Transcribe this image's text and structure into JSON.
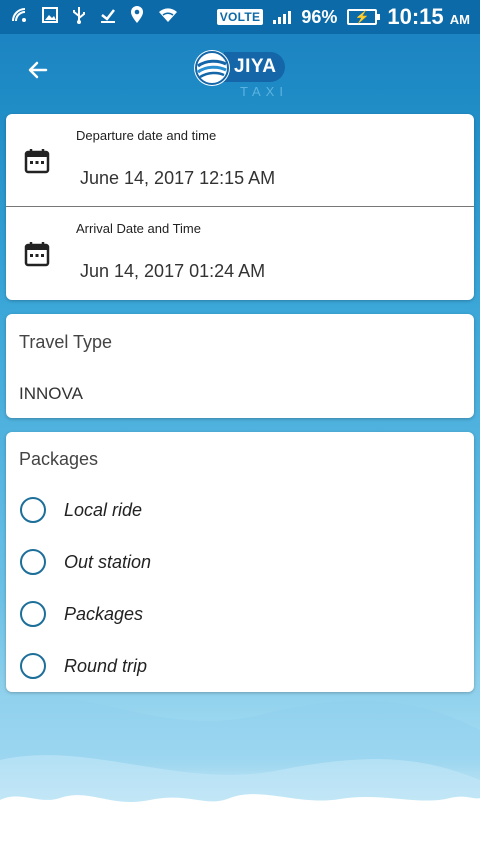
{
  "status_bar": {
    "volte": "VOLTE",
    "battery_percent": "96%",
    "time": "10:15",
    "am_pm": "AM",
    "icons": [
      "nfc-icon",
      "image-icon",
      "usb-icon",
      "download-icon",
      "location-icon",
      "wifi-icon",
      "signal-icon",
      "battery-charging-icon"
    ]
  },
  "header": {
    "back_icon": "arrow-left-icon",
    "logo_name": "JIYA",
    "logo_sub": "TAXI"
  },
  "dates": {
    "departure": {
      "label": "Departure date and time",
      "value": "June 14, 2017 12:15 AM",
      "icon": "calendar-icon"
    },
    "arrival": {
      "label": "Arrival Date and Time",
      "value": "Jun 14, 2017 01:24 AM",
      "icon": "calendar-icon"
    }
  },
  "travel_type": {
    "title": "Travel Type",
    "value": "INNOVA"
  },
  "packages": {
    "title": "Packages",
    "options": [
      {
        "label": "Local ride",
        "selected": false
      },
      {
        "label": "Out station",
        "selected": false
      },
      {
        "label": "Packages",
        "selected": false
      },
      {
        "label": "Round trip",
        "selected": false
      }
    ]
  },
  "colors": {
    "primary": "#0d6aa8",
    "radio": "#1d6f9a",
    "background_top": "#1f8cc6"
  }
}
